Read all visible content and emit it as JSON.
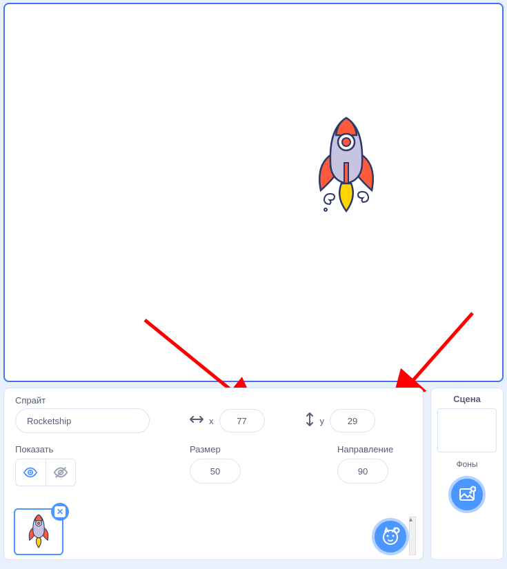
{
  "sprite": {
    "section_label": "Спрайт",
    "name": "Rocketship",
    "x_label": "x",
    "x_value": "77",
    "y_label": "y",
    "y_value": "29",
    "show_label": "Показать",
    "size_label": "Размер",
    "size_value": "50",
    "direction_label": "Направление",
    "direction_value": "90"
  },
  "scene": {
    "title": "Сцена",
    "backdrops_label": "Фоны"
  },
  "icons": {
    "horizontal_arrows": "↔",
    "vertical_arrows": "↕",
    "eye": "eye-icon",
    "eye_off": "eye-off-icon",
    "cat_plus": "cat-plus-icon",
    "image_plus": "image-plus-icon",
    "delete_x": "✕"
  }
}
